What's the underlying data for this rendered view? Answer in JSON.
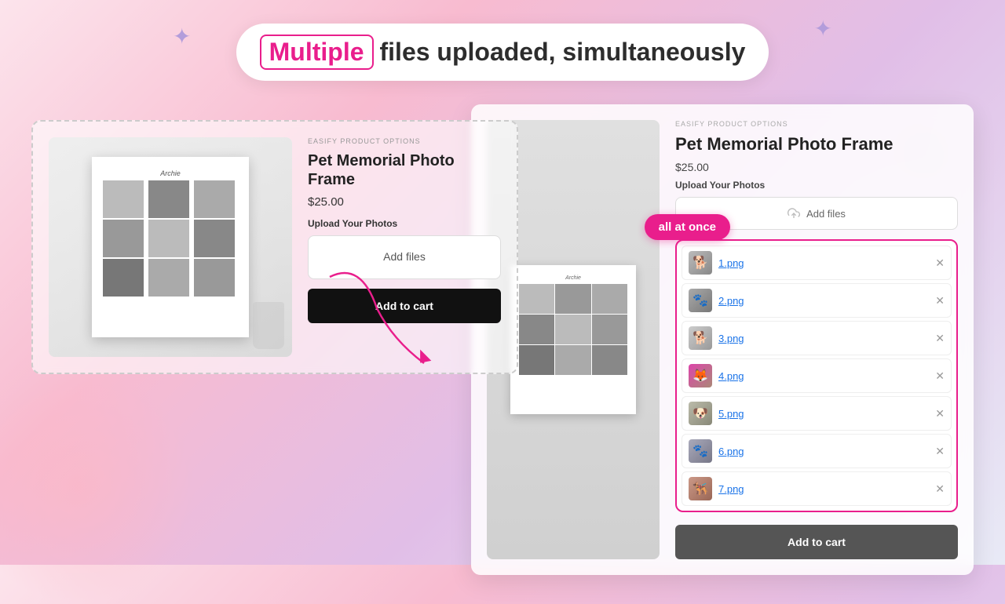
{
  "header": {
    "multiple_label": "Multiple",
    "rest_label": "files uploaded, simultaneously"
  },
  "left_card": {
    "easify_label": "EASIFY PRODUCT OPTIONS",
    "product_title": "Pet Memorial Photo Frame",
    "price": "$25.00",
    "upload_label": "Upload Your Photos",
    "add_files_label": "Add files",
    "add_to_cart_label": "Add to cart"
  },
  "right_card": {
    "easify_label": "EASIFY PRODUCT OPTIONS",
    "product_title": "Pet Memorial Photo Frame",
    "price": "$25.00",
    "upload_label": "Upload Your Photos",
    "add_files_label": "Add files",
    "add_to_cart_label": "Add to cart",
    "all_at_once_badge": "all at once"
  },
  "files": [
    {
      "name": "1.png",
      "id": 1
    },
    {
      "name": "2.png",
      "id": 2
    },
    {
      "name": "3.png",
      "id": 3
    },
    {
      "name": "4.png",
      "id": 4
    },
    {
      "name": "5.png",
      "id": 5
    },
    {
      "name": "6.png",
      "id": 6
    },
    {
      "name": "7.png",
      "id": 7
    }
  ],
  "colors": {
    "pink_accent": "#e91e8c",
    "dark_btn": "#111111"
  }
}
